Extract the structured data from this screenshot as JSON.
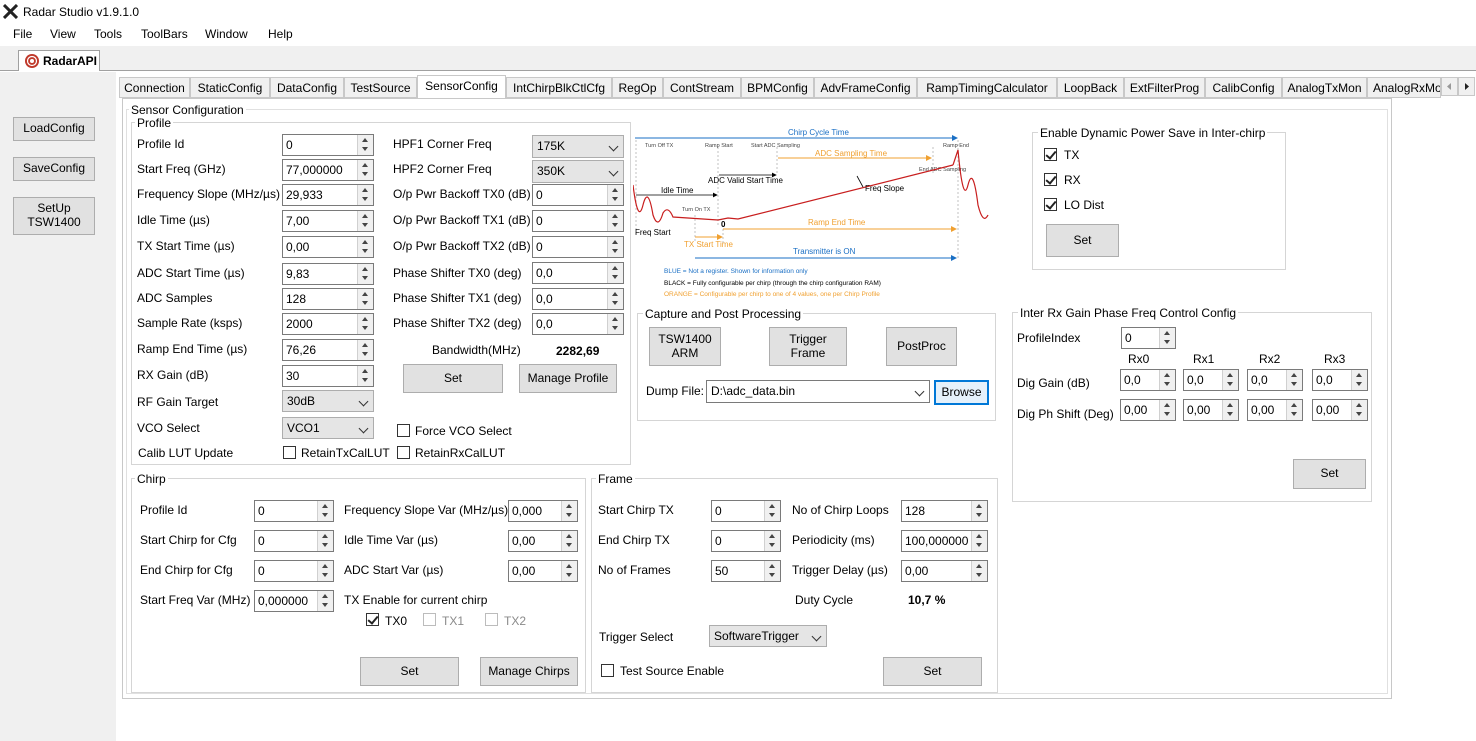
{
  "window": {
    "title": "Radar Studio v1.9.1.0"
  },
  "menu": [
    "File",
    "View",
    "Tools",
    "ToolBars",
    "Window",
    "Help"
  ],
  "doc_tab": "RadarAPI",
  "left_buttons": {
    "load": "LoadConfig",
    "save": "SaveConfig",
    "setup": "SetUp\nTSW1400"
  },
  "tabs": [
    "Connection",
    "StaticConfig",
    "DataConfig",
    "TestSource",
    "SensorConfig",
    "IntChirpBlkCtlCfg",
    "RegOp",
    "ContStream",
    "BPMConfig",
    "AdvFrameConfig",
    "RampTimingCalculator",
    "LoopBack",
    "ExtFilterProg",
    "CalibConfig",
    "AnalogTxMon",
    "AnalogRxMo"
  ],
  "sensor_config_title": "Sensor Configuration",
  "profile": {
    "title": "Profile",
    "fields": [
      {
        "label": "Profile Id",
        "value": "0"
      },
      {
        "label": "Start Freq (GHz)",
        "value": "77,000000"
      },
      {
        "label": "Frequency Slope (MHz/µs)",
        "value": "29,933"
      },
      {
        "label": "Idle Time (µs)",
        "value": "7,00"
      },
      {
        "label": "TX Start Time (µs)",
        "value": "0,00"
      },
      {
        "label": "ADC Start Time (µs)",
        "value": "9,83"
      },
      {
        "label": "ADC Samples",
        "value": "128"
      },
      {
        "label": "Sample Rate (ksps)",
        "value": "2000"
      },
      {
        "label": "Ramp End Time (µs)",
        "value": "76,26"
      },
      {
        "label": "RX Gain (dB)",
        "value": "30"
      }
    ],
    "rf_gain_target": {
      "label": "RF Gain Target",
      "value": "30dB"
    },
    "vco_select": {
      "label": "VCO Select",
      "value": "VCO1"
    },
    "calib_lut": {
      "label": "Calib LUT Update",
      "retain_tx": "RetainTxCalLUT",
      "retain_rx": "RetainRxCalLUT"
    },
    "force_vco": "Force VCO Select",
    "right_fields": [
      {
        "label": "HPF1 Corner Freq",
        "value": "175K",
        "type": "select"
      },
      {
        "label": "HPF2 Corner Freq",
        "value": "350K",
        "type": "select"
      },
      {
        "label": "O/p Pwr Backoff TX0 (dB)",
        "value": "0"
      },
      {
        "label": "O/p Pwr Backoff TX1 (dB)",
        "value": "0"
      },
      {
        "label": "O/p Pwr Backoff TX2 (dB)",
        "value": "0"
      },
      {
        "label": "Phase Shifter TX0 (deg)",
        "value": "0,0"
      },
      {
        "label": "Phase Shifter TX1 (deg)",
        "value": "0,0"
      },
      {
        "label": "Phase Shifter TX2 (deg)",
        "value": "0,0"
      }
    ],
    "bandwidth": {
      "label": "Bandwidth(MHz)",
      "value": "2282,69"
    },
    "set": "Set",
    "manage": "Manage Profile"
  },
  "diagram": {
    "chirp_cycle": "Chirp Cycle Time",
    "turn_off_tx": "Turn Off TX",
    "ramp_start": "Ramp Start",
    "start_adc": "Start ADC Sampling",
    "ramp_end": "Ramp End",
    "adc_sampling_time": "ADC Sampling Time",
    "end_adc": "End ADC\nSampling",
    "adc_valid": "ADC Valid Start Time",
    "idle_time": "Idle Time",
    "freq_slope": "Freq Slope",
    "turn_on_tx": "Turn On TX",
    "zero": "0",
    "ramp_end_time": "Ramp End Time",
    "freq_start": "Freq Start",
    "tx_start_time": "TX Start Time",
    "tx_on": "Transmitter is ON",
    "legend_blue": "BLUE = Not a register. Shown for information only",
    "legend_black": "BLACK = Fully configurable per chirp (through the chirp configuration RAM)",
    "legend_orange": "ORANGE = Configurable per chirp to one of 4 values, one per Chirp Profile"
  },
  "power_save": {
    "title": "Enable Dynamic Power Save in Inter-chirp",
    "tx": "TX",
    "rx": "RX",
    "lo": "LO Dist",
    "set": "Set"
  },
  "capture": {
    "title": "Capture and Post Processing",
    "arm": "TSW1400\nARM",
    "trigger": "Trigger\nFrame",
    "postproc": "PostProc",
    "dump_label": "Dump File:",
    "dump_value": "D:\\adc_data.bin",
    "browse": "Browse"
  },
  "rxgain": {
    "title": "Inter Rx Gain Phase Freq Control Config",
    "profile_index_label": "ProfileIndex",
    "profile_index": "0",
    "cols": [
      "Rx0",
      "Rx1",
      "Rx2",
      "Rx3"
    ],
    "dig_gain_label": "Dig Gain (dB)",
    "dig_gain": [
      "0,0",
      "0,0",
      "0,0",
      "0,0"
    ],
    "dig_ph_label": "Dig Ph Shift (Deg)",
    "dig_ph": [
      "0,00",
      "0,00",
      "0,00",
      "0,00"
    ],
    "set": "Set"
  },
  "chirp": {
    "title": "Chirp",
    "left": [
      {
        "label": "Profile Id",
        "value": "0"
      },
      {
        "label": "Start Chirp for Cfg",
        "value": "0"
      },
      {
        "label": "End Chirp for Cfg",
        "value": "0"
      },
      {
        "label": "Start Freq Var (MHz)",
        "value": "0,000000"
      }
    ],
    "right": [
      {
        "label": "Frequency Slope Var (MHz/µs)",
        "value": "0,000"
      },
      {
        "label": "Idle Time Var (µs)",
        "value": "0,00"
      },
      {
        "label": "ADC Start Var (µs)",
        "value": "0,00"
      }
    ],
    "tx_enable": "TX Enable for current chirp",
    "tx": [
      "TX0",
      "TX1",
      "TX2"
    ],
    "set": "Set",
    "manage": "Manage Chirps"
  },
  "frame": {
    "title": "Frame",
    "left": [
      {
        "label": "Start Chirp TX",
        "value": "0"
      },
      {
        "label": "End Chirp TX",
        "value": "0"
      },
      {
        "label": "No of Frames",
        "value": "50"
      }
    ],
    "right": [
      {
        "label": "No of Chirp Loops",
        "value": "128"
      },
      {
        "label": "Periodicity (ms)",
        "value": "100,000000"
      },
      {
        "label": "Trigger Delay (µs)",
        "value": "0,00"
      }
    ],
    "duty_label": "Duty Cycle",
    "duty_value": "10,7 %",
    "trigger_select_label": "Trigger Select",
    "trigger_select": "SoftwareTrigger",
    "test_source": "Test Source Enable",
    "set": "Set"
  }
}
